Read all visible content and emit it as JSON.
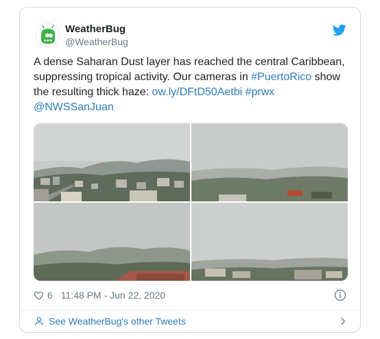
{
  "tweet": {
    "author_name": "WeatherBug",
    "author_handle": "@WeatherBug",
    "text_plain_1": "A dense Saharan Dust layer has reached the central Caribbean, suppressing tropical activity. Our cameras in ",
    "hashtag_1": "#PuertoRico",
    "text_plain_2": " show the resulting thick haze: ",
    "link": "ow.ly/DFtD50Aetbi",
    "text_plain_3": " ",
    "hashtag_2": "#prwx",
    "text_plain_4": " ",
    "mention": "@NWSSanJuan",
    "like_count": "6",
    "timestamp": "11:48 PM - Jun 22, 2020",
    "footer_link": "See WeatherBug's other Tweets"
  },
  "icons": {
    "brand": "twitter-bird-icon",
    "avatar": "weatherbug-logo",
    "like": "heart-icon",
    "info": "info-icon",
    "footer": "person-icon",
    "chevron": "chevron-right-icon"
  },
  "colors": {
    "link": "#2b7bb9",
    "twitter_blue": "#1da1f2",
    "muted": "#697882",
    "border": "#cfd9de",
    "avatar_green": "#3fb24a"
  }
}
